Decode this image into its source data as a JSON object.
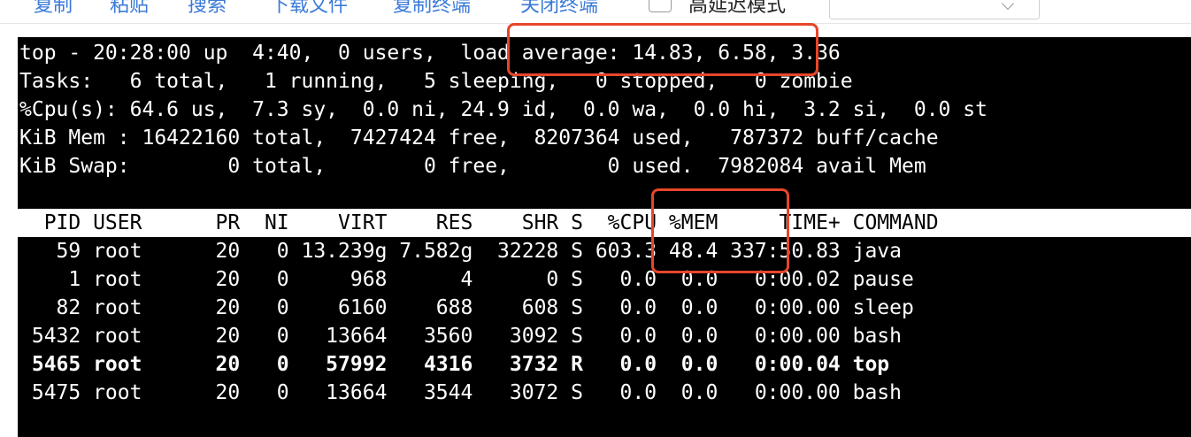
{
  "toolbar": {
    "copy": "复制",
    "paste": "粘贴",
    "search": "搜索",
    "download_file": "下载文件",
    "copy_terminal": "复制终端",
    "close_terminal": "关闭终端",
    "high_latency_mode_label": "高延迟模式",
    "high_latency_mode_checked": false,
    "select_value": ""
  },
  "terminal": {
    "summary": [
      "top - 20:28:00 up  4:40,  0 users,  load average: 14.83, 6.58, 3.36",
      "Tasks:   6 total,   1 running,   5 sleeping,   0 stopped,   0 zombie",
      "%Cpu(s): 64.6 us,  7.3 sy,  0.0 ni, 24.9 id,  0.0 wa,  0.0 hi,  3.2 si,  0.0 st",
      "KiB Mem : 16422160 total,  7427424 free,  8207364 used,   787372 buff/cache",
      "KiB Swap:        0 total,        0 free,        0 used.  7982084 avail Mem"
    ],
    "header": "  PID USER      PR  NI    VIRT    RES    SHR S  %CPU %MEM     TIME+ COMMAND",
    "processes": [
      "   59 root      20   0 13.239g 7.582g  32228 S 603.3 48.4 337:50.83 java",
      "    1 root      20   0     968      4      0 S   0.0  0.0   0:00.02 pause",
      "   82 root      20   0    6160    688    608 S   0.0  0.0   0:00.00 sleep",
      " 5432 root      20   0   13664   3560   3092 S   0.0  0.0   0:00.00 bash",
      " 5465 root      20   0   57992   4316   3732 R   0.0  0.0   0:00.04 top",
      " 5475 root      20   0   13664   3544   3072 S   0.0  0.0   0:00.00 bash"
    ]
  },
  "colors": {
    "accent_link": "#3a7ad8",
    "highlight_box": "#e8452a",
    "terminal_bg": "#000000",
    "terminal_fg": "#ffffff"
  }
}
